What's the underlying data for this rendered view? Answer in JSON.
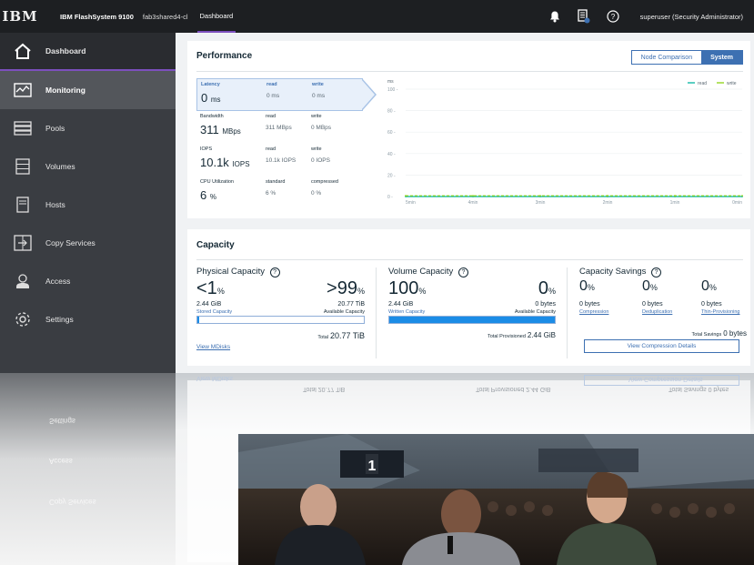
{
  "topbar": {
    "logo": "IBM",
    "product": "IBM FlashSystem 9100",
    "system_name": "fab3shared4-cl",
    "breadcrumb": "Dashboard",
    "user": "superuser (Security Administrator)"
  },
  "sidebar": {
    "items": [
      {
        "label": "Dashboard",
        "icon": "home-icon"
      },
      {
        "label": "Monitoring",
        "icon": "monitoring-icon"
      },
      {
        "label": "Pools",
        "icon": "pools-icon"
      },
      {
        "label": "Volumes",
        "icon": "volumes-icon"
      },
      {
        "label": "Hosts",
        "icon": "hosts-icon"
      },
      {
        "label": "Copy Services",
        "icon": "copy-services-icon"
      },
      {
        "label": "Access",
        "icon": "access-icon"
      },
      {
        "label": "Settings",
        "icon": "settings-icon"
      }
    ]
  },
  "performance": {
    "title": "Performance",
    "toggle": {
      "node": "Node Comparison",
      "system": "System"
    },
    "latency": {
      "label": "Latency",
      "value": "0",
      "unit": "ms",
      "read_label": "read",
      "read": "0 ms",
      "write_label": "write",
      "write": "0 ms"
    },
    "bandwidth": {
      "label": "Bandwidth",
      "value": "311",
      "unit": "MBps",
      "read_label": "read",
      "read": "311 MBps",
      "write_label": "write",
      "write": "0 MBps"
    },
    "iops": {
      "label": "IOPS",
      "value": "10.1k",
      "unit": "IOPS",
      "read_label": "read",
      "read": "10.1k IOPS",
      "write_label": "write",
      "write": "0 IOPS"
    },
    "cpu": {
      "label": "CPU Utilization",
      "value": "6",
      "unit": "%",
      "standard_label": "standard",
      "standard": "6 %",
      "compressed_label": "compressed",
      "compressed": "0 %"
    }
  },
  "chart_data": {
    "type": "line",
    "ylabel": "ms",
    "ylim": [
      0,
      100
    ],
    "yticks": [
      "100 -",
      "80 -",
      "60 -",
      "40 -",
      "20 -",
      "0 -"
    ],
    "categories": [
      "5min",
      "4min",
      "3min",
      "2min",
      "1min",
      "0min"
    ],
    "series": [
      {
        "name": "read",
        "color": "#00b4a0",
        "values": [
          0,
          0,
          0,
          0,
          0,
          0
        ]
      },
      {
        "name": "write",
        "color": "#8cd211",
        "values": [
          0,
          0,
          0,
          0,
          0,
          0
        ]
      }
    ],
    "grid": true,
    "legend": "top-right"
  },
  "capacity": {
    "title": "Capacity",
    "physical": {
      "title": "Physical Capacity",
      "used_pct": "<1",
      "avail_pct": ">99",
      "pct_unit": "%",
      "stored": "2.44 GiB",
      "stored_label": "Stored Capacity",
      "available": "20.77 TiB",
      "available_label": "Available Capacity",
      "total_label": "Total",
      "total": "20.77 TiB",
      "fill": 0.01,
      "link": "View MDisks"
    },
    "volume": {
      "title": "Volume Capacity",
      "written_pct": "100",
      "avail_pct": "0",
      "pct_unit": "%",
      "written": "2.44 GiB",
      "written_label": "Written Capacity",
      "available": "0 bytes",
      "available_label": "Available Capacity",
      "total_label": "Total Provisioned",
      "total": "2.44 GiB",
      "fill": 1.0
    },
    "savings": {
      "title": "Capacity Savings",
      "compression_pct": "0",
      "dedup_pct": "0",
      "thin_pct": "0",
      "pct_unit": "%",
      "compression": "0 bytes",
      "compression_label": "Compression",
      "dedup": "0 bytes",
      "dedup_label": "Deduplication",
      "thin": "0 bytes",
      "thin_label": "Thin-Provisioning",
      "total_label": "Total Savings",
      "total": "0 bytes",
      "button": "View Compression Details"
    }
  },
  "reflection": {
    "link": "View MDisks",
    "total_physical": "Total 20.77 TiB",
    "total_provisioned": "Total Provisioned 2.44 GiB",
    "button": "View Compression Details",
    "total_savings": "Total Savings 0 bytes",
    "nav": [
      "Settings",
      "Access",
      "Copy Services"
    ]
  },
  "video": {
    "scoreboard": "1"
  }
}
